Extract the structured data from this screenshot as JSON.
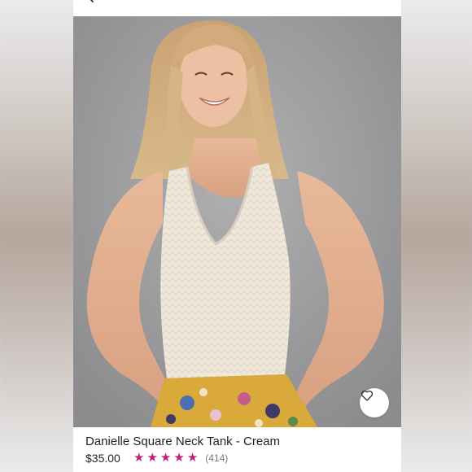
{
  "product": {
    "title": "Danielle Square Neck Tank - Cream",
    "price": "$35.00",
    "rating": 5,
    "review_count": "(414)"
  },
  "icons": {
    "back": "chevron-left-icon",
    "favorite": "heart-icon",
    "star": "star-icon"
  },
  "colors": {
    "star": "#c1207a",
    "tank": "#efe7da",
    "background": "#9c9c9e"
  }
}
